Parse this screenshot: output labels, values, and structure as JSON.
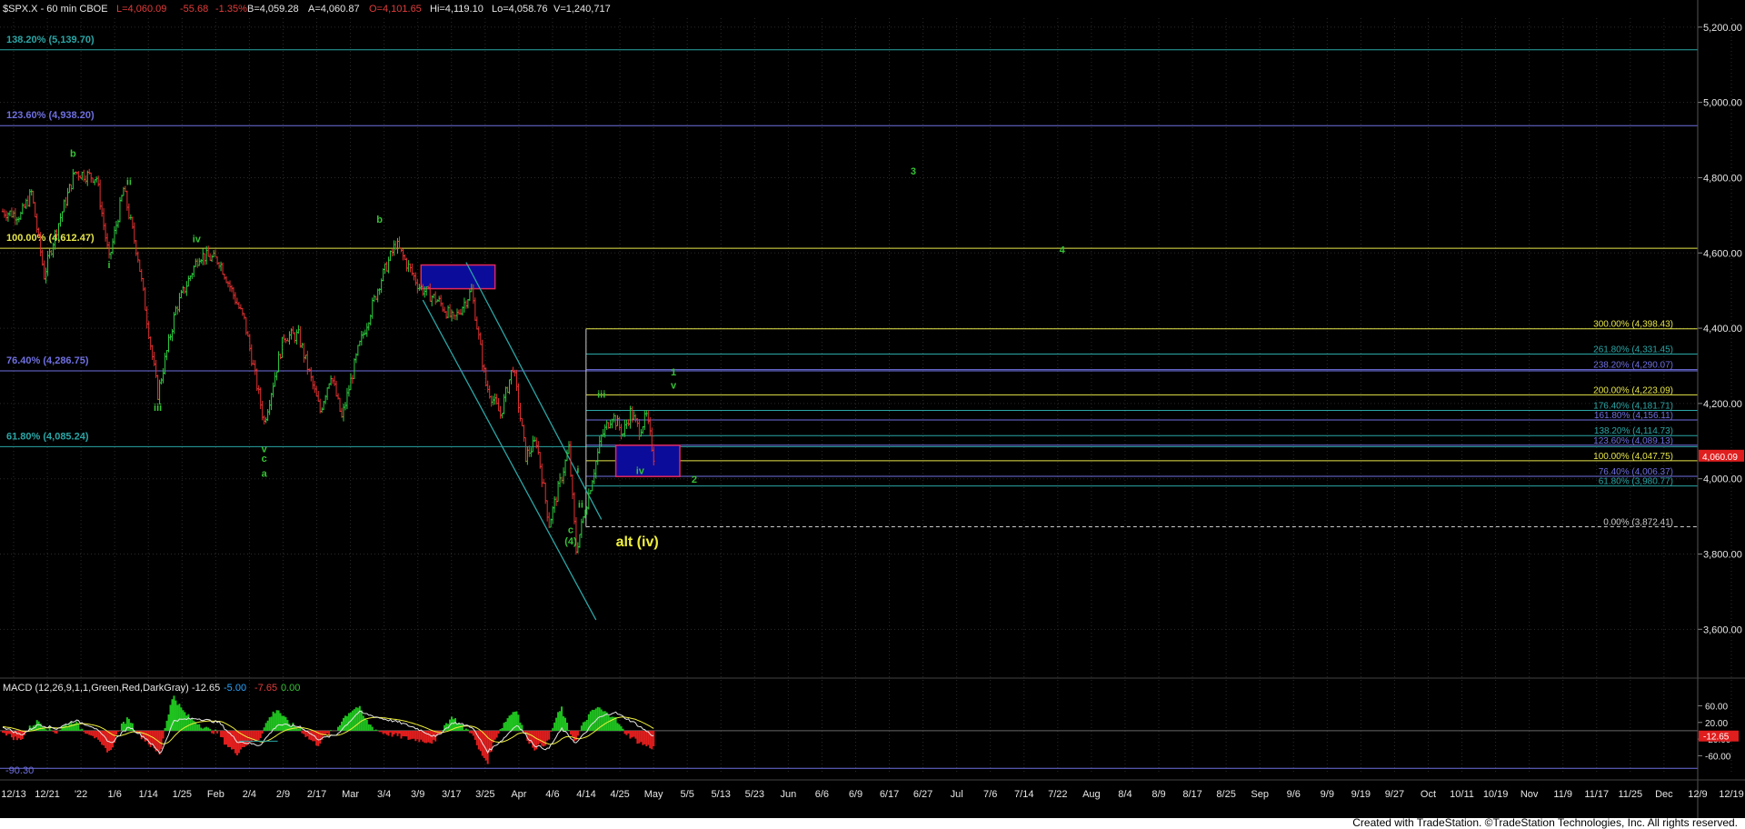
{
  "header": {
    "symbol": "$SPX.X - 60 min CBOE",
    "last": "L=4,060.09",
    "change": "-55.68",
    "change_pct": "-1.35%",
    "bid": "B=4,059.28",
    "ask": "A=4,060.87",
    "open": "O=4,101.65",
    "high": "Hi=4,119.10",
    "low": "Lo=4,058.76",
    "volume": "V=1,240,717"
  },
  "colors": {
    "background": "#000000",
    "grid": "#2b2b2b",
    "up_bar": "#2ecc40",
    "down_bar": "#e63232",
    "wave_label": "#36c236",
    "fib_blue": "#6f6fe0",
    "fib_teal": "#2aa6a6",
    "fib_yellow": "#e6e64a",
    "box_fill": "#0c0c9a",
    "box_border": "#e0285c"
  },
  "price_axis": {
    "ticks": [
      "5,200.00",
      "5,000.00",
      "4,800.00",
      "4,600.00",
      "4,400.00",
      "4,200.00",
      "4,000.00",
      "3,800.00",
      "3,600.00"
    ],
    "current_price_tag": "4,060.09"
  },
  "date_axis": {
    "ticks": [
      "12/13",
      "12/21",
      "'22",
      "1/6",
      "1/14",
      "1/25",
      "Feb",
      "2/4",
      "2/9",
      "2/17",
      "Mar",
      "3/4",
      "3/9",
      "3/17",
      "3/25",
      "Apr",
      "4/6",
      "4/14",
      "4/25",
      "May",
      "5/5",
      "5/13",
      "5/23",
      "Jun",
      "6/6",
      "6/9",
      "6/17",
      "6/27",
      "Jul",
      "7/6",
      "7/14",
      "7/22",
      "Aug",
      "8/4",
      "8/9",
      "8/17",
      "8/25",
      "Sep",
      "9/6",
      "9/9",
      "9/19",
      "9/27",
      "Oct",
      "10/11",
      "10/19",
      "Nov",
      "11/9",
      "11/17",
      "11/25",
      "Dec",
      "12/9",
      "12/19"
    ]
  },
  "left_fibs": [
    {
      "label": "138.20% (5,139.70)",
      "price": 5139.7,
      "color": "#2aa6a6"
    },
    {
      "label": "123.60% (4,938.20)",
      "price": 4938.2,
      "color": "#6f6fe0"
    },
    {
      "label": "100.00% (4,612.47)",
      "price": 4612.47,
      "color": "#e6e64a"
    },
    {
      "label": "76.40% (4,286.75)",
      "price": 4286.75,
      "color": "#6f6fe0"
    },
    {
      "label": "61.80% (4,085.24)",
      "price": 4085.24,
      "color": "#2aa6a6"
    }
  ],
  "right_fibs": [
    {
      "label": "300.00% (4,398.43)",
      "price": 4398.43,
      "color": "#e6e64a"
    },
    {
      "label": "261.80% (4,331.45)",
      "price": 4331.45,
      "color": "#2aa6a6"
    },
    {
      "label": "238.20% (4,290.07)",
      "price": 4290.07,
      "color": "#6f6fe0"
    },
    {
      "label": "200.00% (4,223.09)",
      "price": 4223.09,
      "color": "#e6e64a"
    },
    {
      "label": "176.40% (4,181.71)",
      "price": 4181.71,
      "color": "#2aa6a6"
    },
    {
      "label": "161.80% (4,156.11)",
      "price": 4156.11,
      "color": "#6f6fe0"
    },
    {
      "label": "138.20% (4,114.73)",
      "price": 4114.73,
      "color": "#2aa6a6"
    },
    {
      "label": "123.60% (4,089.13)",
      "price": 4089.13,
      "color": "#6f6fe0"
    },
    {
      "label": "100.00% (4,047.75)",
      "price": 4047.75,
      "color": "#e6e64a"
    },
    {
      "label": "76.40% (4,006.37)",
      "price": 4006.37,
      "color": "#6f6fe0"
    },
    {
      "label": "61.80% (3,980.77)",
      "price": 3980.77,
      "color": "#2aa6a6"
    },
    {
      "label": "0.00% (3,872.41)",
      "price": 3872.41,
      "color": "#cccccc"
    }
  ],
  "wave_labels": [
    {
      "text": "b",
      "price": 4855,
      "bar": 78
    },
    {
      "text": "ii",
      "price": 4780,
      "bar": 140
    },
    {
      "text": "i",
      "price": 4560,
      "bar": 118
    },
    {
      "text": "iv",
      "price": 4628,
      "bar": 215
    },
    {
      "text": "iii",
      "price": 4180,
      "bar": 172
    },
    {
      "text": "v",
      "price": 4070,
      "bar": 290
    },
    {
      "text": "c",
      "price": 4045,
      "bar": 290
    },
    {
      "text": "a",
      "price": 4005,
      "bar": 290
    },
    {
      "text": "b",
      "price": 4680,
      "bar": 418
    },
    {
      "text": "c",
      "price": 3855,
      "bar": 630
    },
    {
      "text": "(4)",
      "price": 3825,
      "bar": 630
    },
    {
      "text": "i",
      "price": 4015,
      "bar": 638
    },
    {
      "text": "ii",
      "price": 3923,
      "bar": 641
    },
    {
      "text": "iii",
      "price": 4215,
      "bar": 664
    },
    {
      "text": "iv",
      "price": 4012,
      "bar": 707
    },
    {
      "text": "1",
      "price": 4275,
      "bar": 744
    },
    {
      "text": "v",
      "price": 4240,
      "bar": 744
    },
    {
      "text": "2",
      "price": 3990,
      "bar": 767
    },
    {
      "text": "3",
      "price": 4808,
      "bar": 1010
    },
    {
      "text": "4",
      "price": 4600,
      "bar": 1175
    }
  ],
  "annotation": {
    "text": "alt (iv)",
    "price": 3820,
    "bar": 680
  },
  "macd": {
    "title": "MACD (12,26,9,1,1,Green,Red,DarkGray)",
    "macd_value": "-12.65",
    "signal_value": "-5.00",
    "hist_value": "-7.65",
    "zero_value": "0.00",
    "ticks": [
      "60.00",
      "20.00",
      "-20.00",
      "-60.00"
    ],
    "low_label": "-90.30",
    "current_tag": "-12.65"
  },
  "chart_data": {
    "type": "ohlc",
    "title": "$SPX.X - 60 min CBOE",
    "ylim": [
      3480,
      5260
    ],
    "y_ticks": [
      5200,
      5000,
      4800,
      4600,
      4400,
      4200,
      4000,
      3800,
      3600
    ],
    "series": [
      {
        "name": "$SPX.X",
        "anchor_points": [
          {
            "bar": 0,
            "price": 4710
          },
          {
            "bar": 20,
            "price": 4700
          },
          {
            "bar": 32,
            "price": 4760
          },
          {
            "bar": 46,
            "price": 4540
          },
          {
            "bar": 58,
            "price": 4650
          },
          {
            "bar": 80,
            "price": 4815
          },
          {
            "bar": 104,
            "price": 4800
          },
          {
            "bar": 118,
            "price": 4580
          },
          {
            "bar": 134,
            "price": 4770
          },
          {
            "bar": 150,
            "price": 4590
          },
          {
            "bar": 172,
            "price": 4225
          },
          {
            "bar": 192,
            "price": 4450
          },
          {
            "bar": 218,
            "price": 4595
          },
          {
            "bar": 240,
            "price": 4580
          },
          {
            "bar": 268,
            "price": 4420
          },
          {
            "bar": 290,
            "price": 4150
          },
          {
            "bar": 312,
            "price": 4380
          },
          {
            "bar": 328,
            "price": 4380
          },
          {
            "bar": 352,
            "price": 4180
          },
          {
            "bar": 364,
            "price": 4280
          },
          {
            "bar": 376,
            "price": 4160
          },
          {
            "bar": 394,
            "price": 4340
          },
          {
            "bar": 418,
            "price": 4520
          },
          {
            "bar": 436,
            "price": 4625
          },
          {
            "bar": 462,
            "price": 4510
          },
          {
            "bar": 484,
            "price": 4470
          },
          {
            "bar": 500,
            "price": 4420
          },
          {
            "bar": 520,
            "price": 4500
          },
          {
            "bar": 536,
            "price": 4250
          },
          {
            "bar": 552,
            "price": 4170
          },
          {
            "bar": 566,
            "price": 4300
          },
          {
            "bar": 580,
            "price": 4060
          },
          {
            "bar": 592,
            "price": 4100
          },
          {
            "bar": 606,
            "price": 3880
          },
          {
            "bar": 618,
            "price": 3990
          },
          {
            "bar": 628,
            "price": 4080
          },
          {
            "bar": 636,
            "price": 3810
          },
          {
            "bar": 650,
            "price": 3960
          },
          {
            "bar": 664,
            "price": 4110
          },
          {
            "bar": 676,
            "price": 4170
          },
          {
            "bar": 688,
            "price": 4120
          },
          {
            "bar": 696,
            "price": 4176
          },
          {
            "bar": 706,
            "price": 4130
          },
          {
            "bar": 714,
            "price": 4165
          },
          {
            "bar": 722,
            "price": 4060
          }
        ]
      }
    ],
    "target_boxes": [
      {
        "name": "upper-target-box",
        "bar_from": 464,
        "bar_to": 546,
        "price_from": 4505,
        "price_to": 4568
      },
      {
        "name": "lower-target-box",
        "bar_from": 680,
        "bar_to": 751,
        "price_from": 4006,
        "price_to": 4089
      }
    ],
    "channel": {
      "upper": [
        {
          "bar": 514,
          "price": 4575
        },
        {
          "bar": 664,
          "price": 3892
        }
      ],
      "lower": [
        {
          "bar": 466,
          "price": 4475
        },
        {
          "bar": 658,
          "price": 3625
        }
      ]
    },
    "right_fib_start_bar": 647,
    "macd_series": {
      "ylim": [
        -105,
        85
      ],
      "anchor_points": [
        {
          "bar": 0,
          "macd": 10
        },
        {
          "bar": 20,
          "macd": -10
        },
        {
          "bar": 40,
          "macd": 15
        },
        {
          "bar": 60,
          "macd": 5
        },
        {
          "bar": 80,
          "macd": 25
        },
        {
          "bar": 100,
          "macd": 10
        },
        {
          "bar": 120,
          "macd": -30
        },
        {
          "bar": 140,
          "macd": 10
        },
        {
          "bar": 160,
          "macd": -20
        },
        {
          "bar": 175,
          "macd": -55
        },
        {
          "bar": 190,
          "macd": 25
        },
        {
          "bar": 215,
          "macd": 30
        },
        {
          "bar": 240,
          "macd": 20
        },
        {
          "bar": 260,
          "macd": -25
        },
        {
          "bar": 285,
          "macd": -35
        },
        {
          "bar": 305,
          "macd": 15
        },
        {
          "bar": 330,
          "macd": 10
        },
        {
          "bar": 350,
          "macd": -20
        },
        {
          "bar": 370,
          "macd": -10
        },
        {
          "bar": 395,
          "macd": 45
        },
        {
          "bar": 420,
          "macd": 30
        },
        {
          "bar": 440,
          "macd": 20
        },
        {
          "bar": 460,
          "macd": 5
        },
        {
          "bar": 480,
          "macd": -15
        },
        {
          "bar": 500,
          "macd": 20
        },
        {
          "bar": 520,
          "macd": 10
        },
        {
          "bar": 538,
          "macd": -50
        },
        {
          "bar": 555,
          "macd": -20
        },
        {
          "bar": 570,
          "macd": 15
        },
        {
          "bar": 590,
          "macd": -35
        },
        {
          "bar": 605,
          "macd": -45
        },
        {
          "bar": 620,
          "macd": 5
        },
        {
          "bar": 636,
          "macd": -30
        },
        {
          "bar": 660,
          "macd": 30
        },
        {
          "bar": 678,
          "macd": 45
        },
        {
          "bar": 700,
          "macd": 20
        },
        {
          "bar": 722,
          "macd": -13
        }
      ]
    }
  },
  "footer": {
    "text": "Created with TradeStation. ©TradeStation Technologies, Inc. All rights reserved."
  }
}
